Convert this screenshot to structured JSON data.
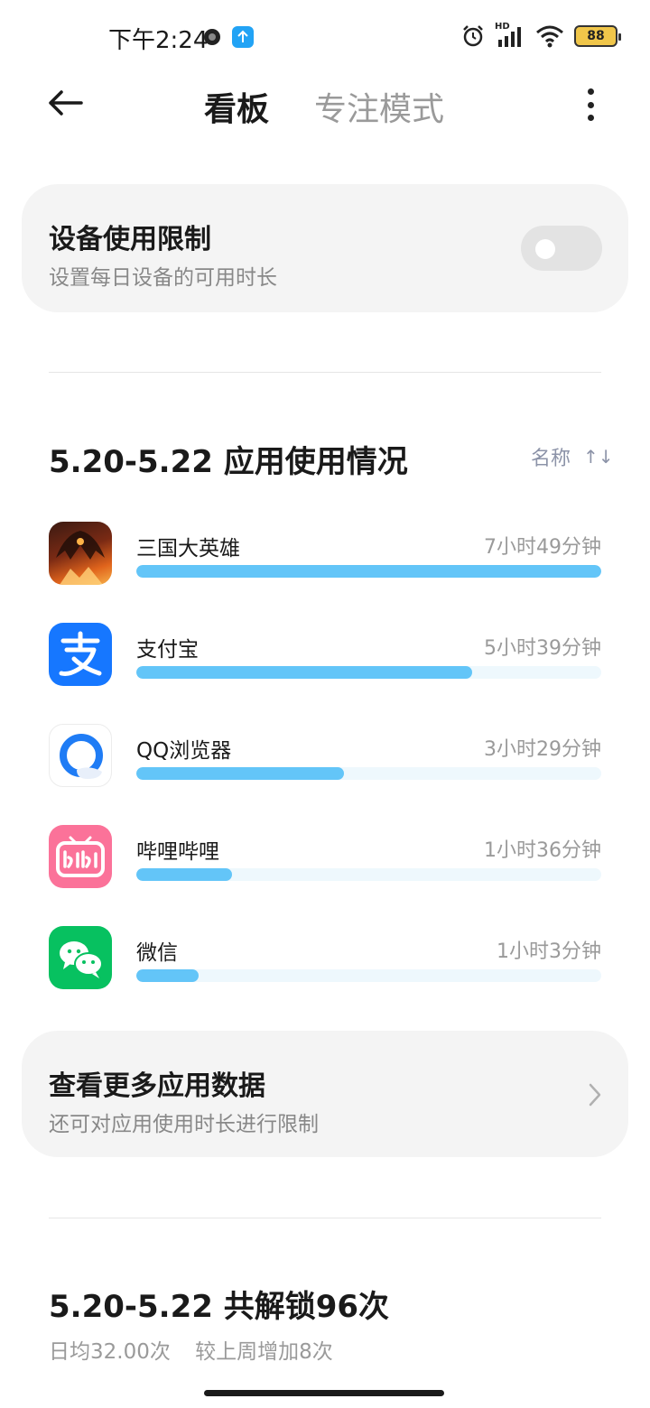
{
  "status_bar": {
    "time": "下午2:24",
    "network_label": "HD",
    "battery": "88"
  },
  "header": {
    "tab_active": "看板",
    "tab_inactive": "专注模式"
  },
  "device_limit": {
    "title": "设备使用限制",
    "subtitle": "设置每日设备的可用时长",
    "toggle_on": false
  },
  "usage": {
    "title": "5.20-5.22 应用使用情况",
    "sort_label": "名称",
    "sort_icon": "↑↓",
    "apps": [
      {
        "name": "三国大英雄",
        "time": "7小时49分钟",
        "fraction": 1.0,
        "icon": "game-icon"
      },
      {
        "name": "支付宝",
        "time": "5小时39分钟",
        "fraction": 0.723,
        "icon": "alipay-icon"
      },
      {
        "name": "QQ浏览器",
        "time": "3小时29分钟",
        "fraction": 0.446,
        "icon": "qq-browser-icon"
      },
      {
        "name": "哔哩哔哩",
        "time": "1小时36分钟",
        "fraction": 0.205,
        "icon": "bilibili-icon"
      },
      {
        "name": "微信",
        "time": "1小时3分钟",
        "fraction": 0.134,
        "icon": "wechat-icon"
      }
    ]
  },
  "more_data": {
    "title": "查看更多应用数据",
    "subtitle": "还可对应用使用时长进行限制"
  },
  "unlock": {
    "title": "5.20-5.22 共解锁96次",
    "daily_avg": "日均32.00次",
    "compare": "较上周增加8次"
  },
  "colors": {
    "bar_fill": "#63c5f8",
    "bar_track": "#eef8fd",
    "card_bg": "#f4f4f4",
    "muted_text": "#9a9a9a"
  }
}
